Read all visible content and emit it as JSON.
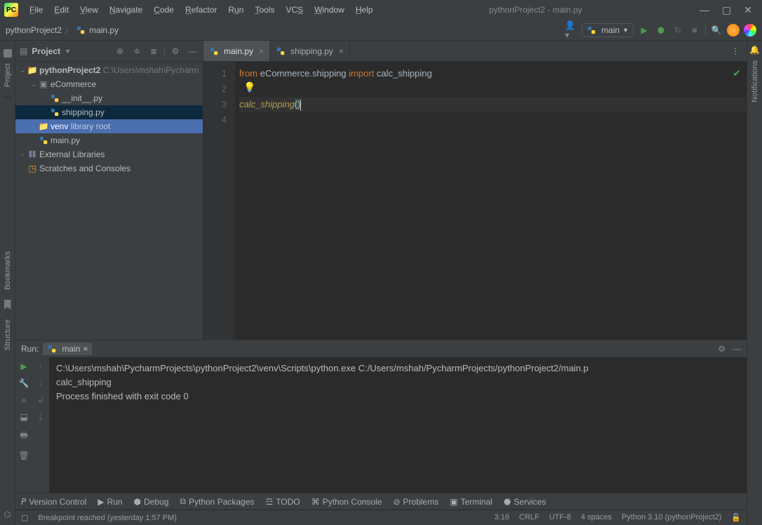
{
  "title": "pythonProject2 - main.py",
  "menu": [
    "File",
    "Edit",
    "View",
    "Navigate",
    "Code",
    "Refactor",
    "Run",
    "Tools",
    "VCS",
    "Window",
    "Help"
  ],
  "breadcrumb": {
    "project": "pythonProject2",
    "file": "main.py"
  },
  "runconfig": "main",
  "project": {
    "pane_title": "Project",
    "root": "pythonProject2",
    "root_path": "C:\\Users\\mshah\\Pycharm",
    "pkg": "eCommerce",
    "init": "__init__.py",
    "shipping": "shipping.py",
    "venv": "venv",
    "venv_hint": "library root",
    "mainfile": "main.py",
    "extlib": "External Libraries",
    "scratches": "Scratches and Consoles"
  },
  "tabs": {
    "main": "main.py",
    "shipping": "shipping.py"
  },
  "code": {
    "line1_from": "from",
    "line1_mod": " eCommerce.shipping ",
    "line1_imp": "import",
    "line1_tail": " calc_shipping",
    "line3_call": "calc_shipping",
    "line3_p1": "(",
    "line3_p2": ")",
    "ln1": "1",
    "ln2": "2",
    "ln3": "3",
    "ln4": "4"
  },
  "run": {
    "label": "Run:",
    "tabname": "main",
    "l1": "C:\\Users\\mshah\\PycharmProjects\\pythonProject2\\venv\\Scripts\\python.exe C:/Users/mshah/PycharmProjects/pythonProject2/main.p",
    "l2": "calc_shipping",
    "l3": "",
    "l4": "Process finished with exit code 0"
  },
  "bottom": {
    "vcs": "Version Control",
    "run": "Run",
    "debug": "Debug",
    "pkgs": "Python Packages",
    "todo": "TODO",
    "pycon": "Python Console",
    "problems": "Problems",
    "terminal": "Terminal",
    "services": "Services"
  },
  "status": {
    "msg": "Breakpoint reached (yesterday 1:57 PM)",
    "pos": "3:16",
    "eol": "CRLF",
    "enc": "UTF-8",
    "indent": "4 spaces",
    "sdk": "Python 3.10 (pythonProject2)"
  },
  "gutter": {
    "project": "Project",
    "bookmarks": "Bookmarks",
    "structure": "Structure",
    "notifications": "Notifications"
  }
}
